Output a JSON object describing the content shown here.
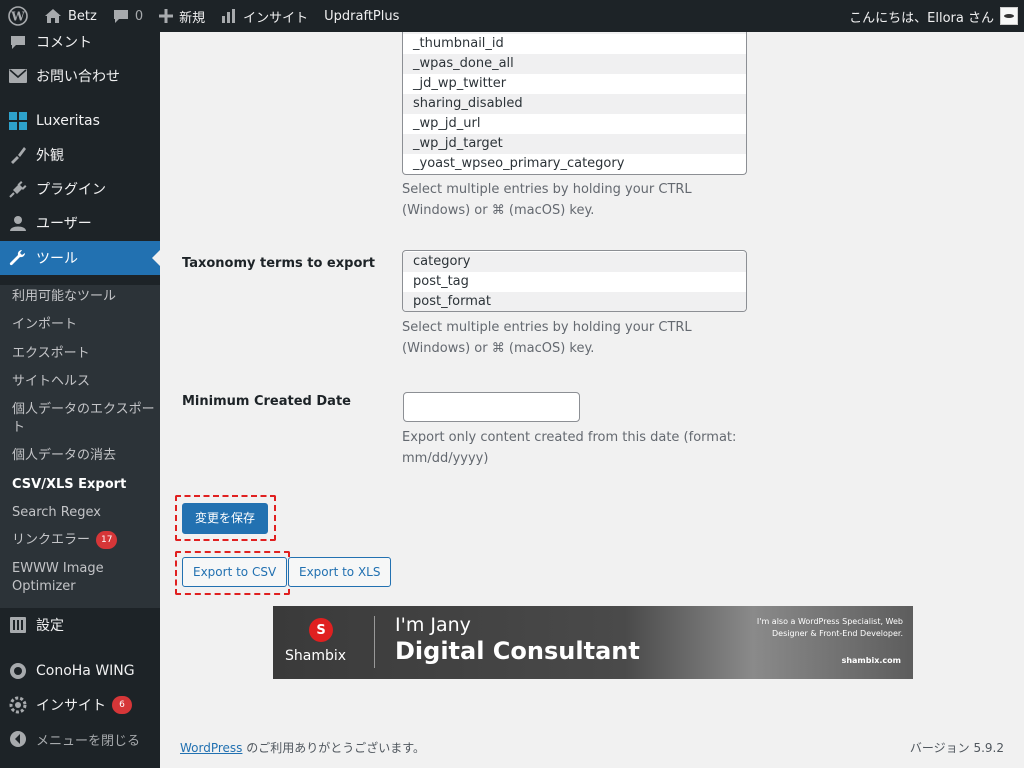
{
  "adminbar": {
    "site_name": "Betz",
    "comments_count": "0",
    "new_label": "新規",
    "insight_label": "インサイト",
    "updraft_label": "UpdraftPlus",
    "greeting": "こんにちは、Ellora さん"
  },
  "sidebar": {
    "comments": "コメント",
    "contact": "お問い合わせ",
    "luxeritas": "Luxeritas",
    "appearance": "外観",
    "plugins": "プラグイン",
    "users": "ユーザー",
    "tools": "ツール",
    "submenu": [
      {
        "label": "利用可能なツール"
      },
      {
        "label": "インポート"
      },
      {
        "label": "エクスポート"
      },
      {
        "label": "サイトヘルス"
      },
      {
        "label": "個人データのエクスポート"
      },
      {
        "label": "個人データの消去"
      },
      {
        "label": "CSV/XLS Export"
      },
      {
        "label": "Search Regex"
      },
      {
        "label": "リンクエラー",
        "badge": "17"
      },
      {
        "label": "EWWW Image Optimizer"
      }
    ],
    "settings": "設定",
    "conoha": "ConoHa WING",
    "insight": "インサイト",
    "insight_badge": "6",
    "collapse": "メニューを閉じる"
  },
  "meta_keys": {
    "options": [
      "_thumbnail_id",
      "_wpas_done_all",
      "_jd_wp_twitter",
      "sharing_disabled",
      "_wp_jd_url",
      "_wp_jd_target",
      "_yoast_wpseo_primary_category"
    ],
    "help": "Select multiple entries by holding your CTRL (Windows) or ⌘ (macOS) key."
  },
  "taxonomy": {
    "label": "Taxonomy terms to export",
    "options": [
      "category",
      "post_tag",
      "post_format"
    ],
    "help": "Select multiple entries by holding your CTRL (Windows) or ⌘ (macOS) key."
  },
  "min_date": {
    "label": "Minimum Created Date",
    "value": "",
    "help": "Export only content created from this date (format: mm/dd/yyyy)"
  },
  "buttons": {
    "save": "変更を保存",
    "export_csv": "Export to CSV",
    "export_xls": "Export to XLS"
  },
  "banner": {
    "brand": "Shambix",
    "hi": "I'm Jany",
    "title": "Digital Consultant",
    "note": "I'm also a WordPress Specialist, Web Designer & Front-End Developer.",
    "site": "shambix.com"
  },
  "footer": {
    "link": "WordPress",
    "thanks": " のご利用ありがとうございます。",
    "version": "バージョン 5.9.2"
  }
}
